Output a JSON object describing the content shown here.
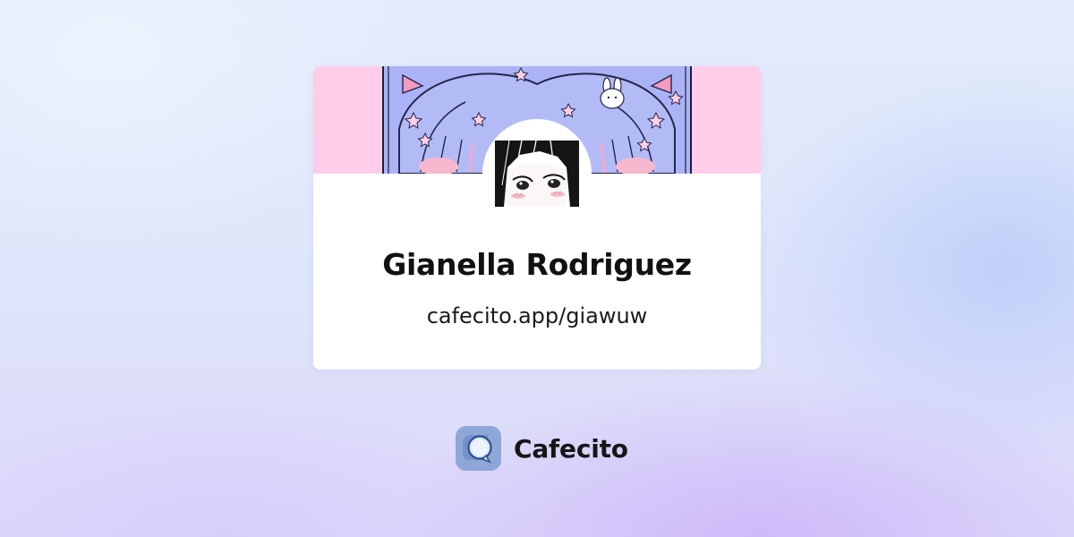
{
  "profile": {
    "name": "Gianella Rodriguez",
    "url": "cafecito.app/giawuw"
  },
  "brand": {
    "name": "Cafecito",
    "icon": "cafecito-cup-icon"
  },
  "colors": {
    "banner_pink": "#ffcde8",
    "artwork_lavender": "#a9b3f5",
    "card_bg": "#ffffff",
    "brand_icon_bg": "#8ea7d6",
    "text_primary": "#111111"
  }
}
